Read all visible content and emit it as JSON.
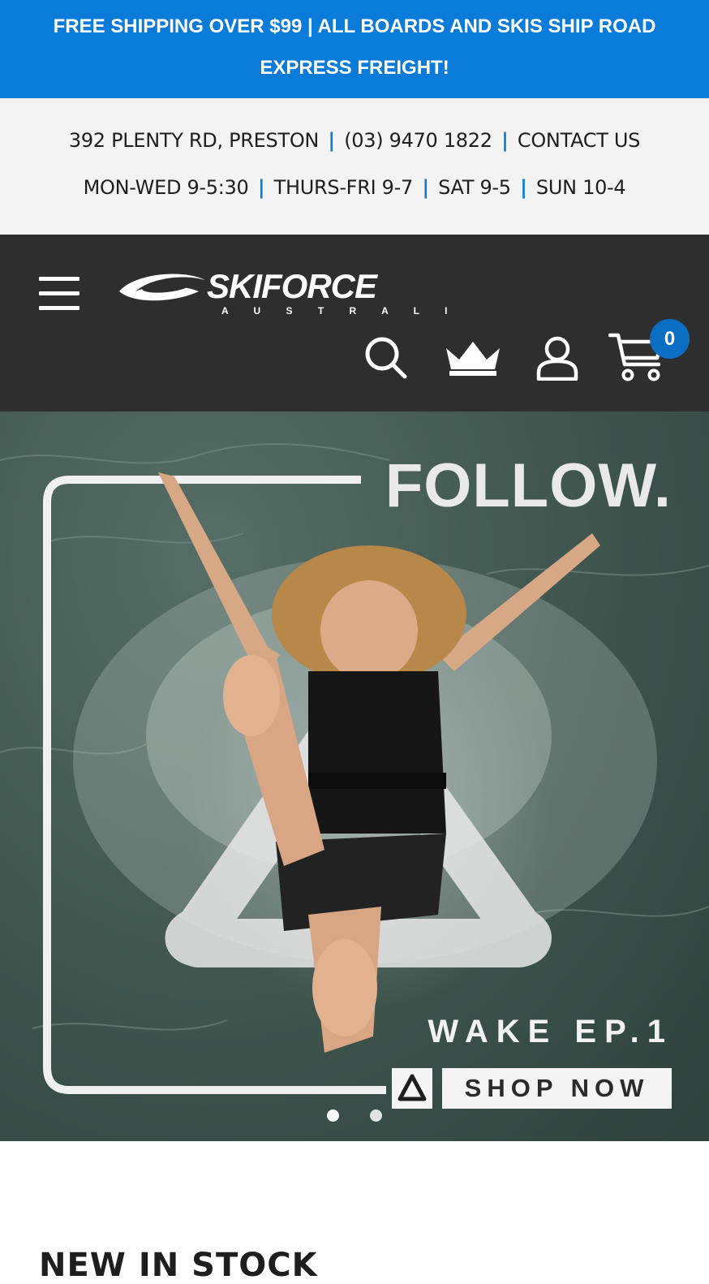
{
  "announcement": {
    "line1": "FREE SHIPPING OVER $99 | ALL BOARDS AND SKIS SHIP ROAD",
    "line2": "EXPRESS FREIGHT!"
  },
  "info_bar": {
    "address": "392 PLENTY RD, PRESTON",
    "phone": "(03) 9470 1822",
    "contact": "CONTACT US",
    "separator": "|",
    "hours": [
      "MON-WED 9-5:30",
      "THURS-FRI 9-7",
      "SAT 9-5",
      "SUN 10-4"
    ]
  },
  "header": {
    "logo_text": "SKIFORCE",
    "logo_subtext": "A U S T R A L I A",
    "cart_count": "0",
    "icons": [
      "menu-icon",
      "search-icon",
      "crown-icon",
      "account-icon",
      "cart-icon"
    ]
  },
  "hero": {
    "headline": "FOLLOW.",
    "subtitle": "WAKE EP.1",
    "cta": "SHOP NOW",
    "slides_total": 2,
    "active_slide": 1
  },
  "sections": {
    "new_in_stock": "NEW IN STOCK"
  },
  "colors": {
    "accent_blue": "#0a7bd9",
    "header_dark": "#2e2e2e",
    "info_bg": "#f3f3f3",
    "badge_blue": "#0a6fc2"
  }
}
